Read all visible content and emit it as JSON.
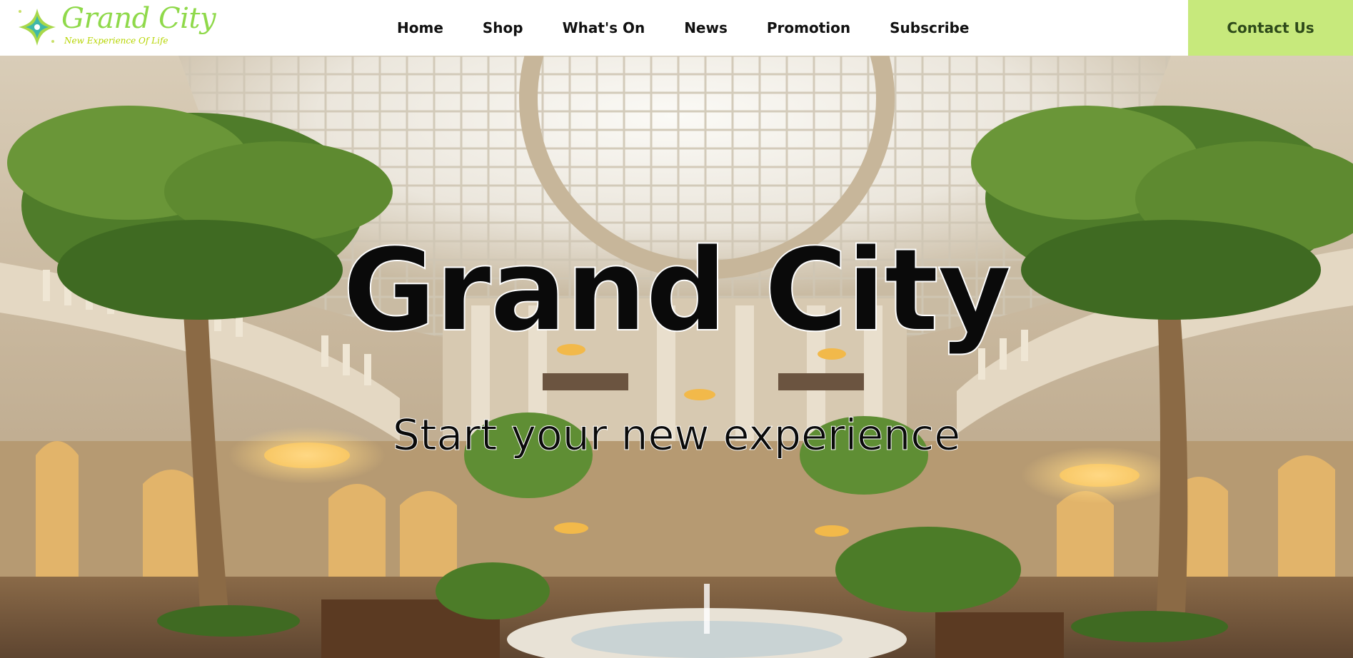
{
  "brand": {
    "name": "Grand City",
    "tagline": "New Experience Of Life",
    "colors": {
      "logo_green": "#8fd94a",
      "logo_yellow": "#b6d500",
      "accent": "#c7e97c"
    }
  },
  "nav": {
    "items": [
      {
        "label": "Home"
      },
      {
        "label": "Shop"
      },
      {
        "label": "What's On"
      },
      {
        "label": "News"
      },
      {
        "label": "Promotion"
      },
      {
        "label": "Subscribe"
      }
    ],
    "contact_label": "Contact Us"
  },
  "hero": {
    "title": "Grand City",
    "subtitle": "Start your new experience",
    "image_subject": "mall-atrium-photo"
  }
}
